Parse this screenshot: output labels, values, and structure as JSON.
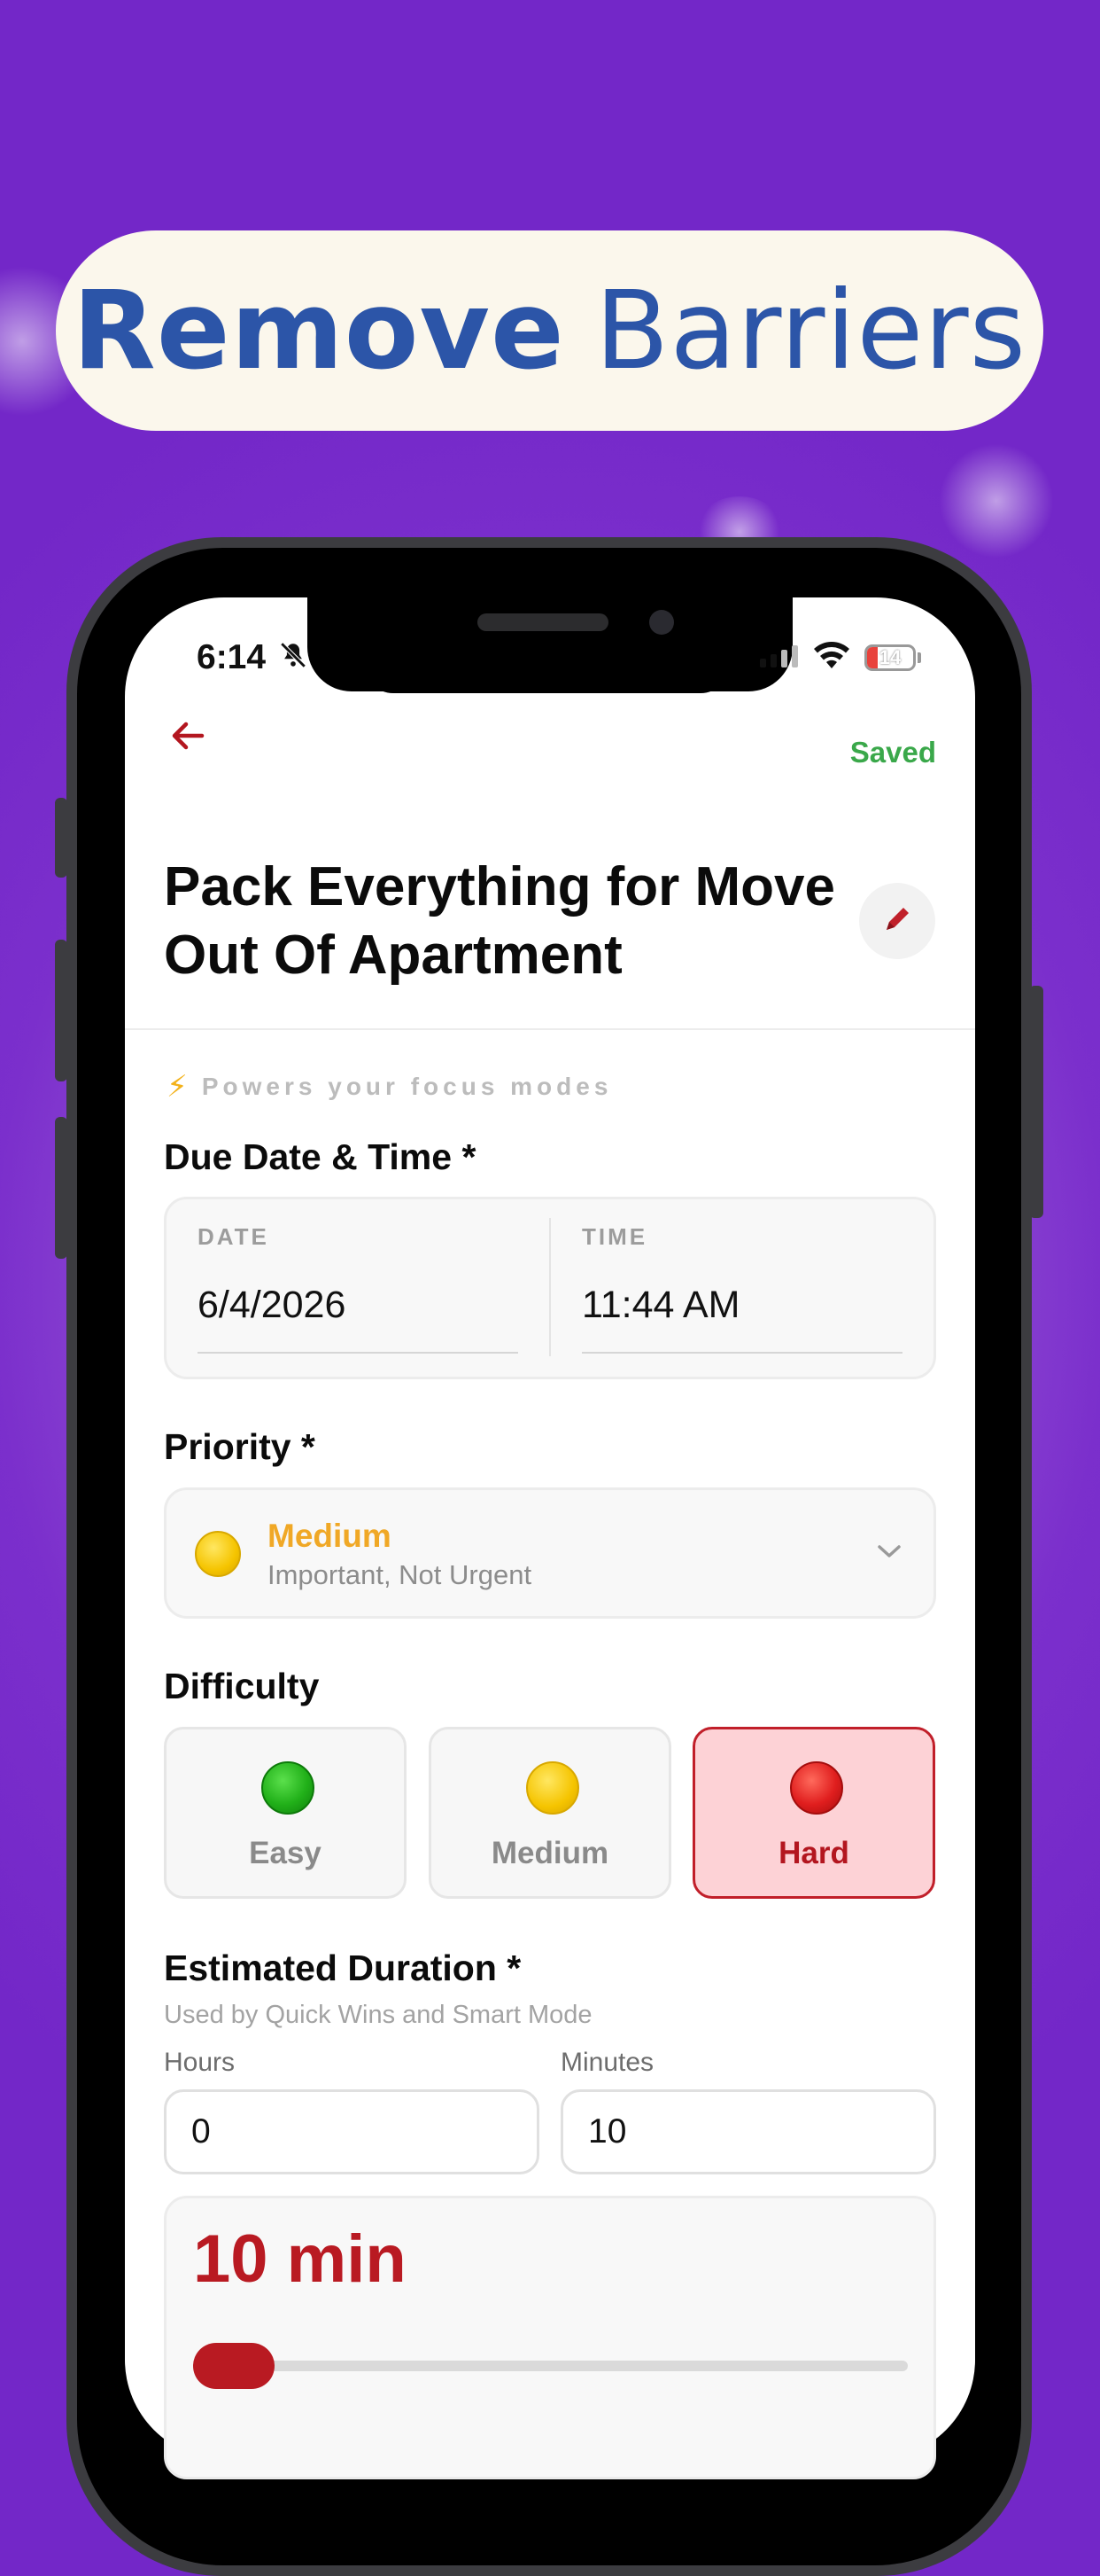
{
  "promo": {
    "headline_bold": "Remove",
    "headline_light": "Barriers"
  },
  "status_bar": {
    "time": "6:14",
    "battery": "14"
  },
  "header": {
    "back_icon": "arrow-left-icon",
    "save_status": "Saved"
  },
  "task": {
    "title": "Pack Everything for Move Out Of Apartment",
    "edit_icon": "pencil-icon"
  },
  "focus_hint": {
    "icon": "lightning-icon",
    "text": "Powers your focus modes"
  },
  "due": {
    "label": "Due Date & Time *",
    "date_caption": "DATE",
    "date_value": "6/4/2026",
    "time_caption": "TIME",
    "time_value": "11:44 AM"
  },
  "priority": {
    "label": "Priority *",
    "name": "Medium",
    "description": "Important, Not Urgent",
    "color": "#f0a826"
  },
  "difficulty": {
    "label": "Difficulty",
    "options": [
      {
        "label": "Easy",
        "color": "green",
        "selected": false
      },
      {
        "label": "Medium",
        "color": "yellow",
        "selected": false
      },
      {
        "label": "Hard",
        "color": "red",
        "selected": true
      }
    ]
  },
  "duration": {
    "label": "Estimated Duration *",
    "hint": "Used by Quick Wins and Smart Mode",
    "hours_label": "Hours",
    "hours_value": "0",
    "minutes_label": "Minutes",
    "minutes_value": "10",
    "summary": "10 min",
    "accent": "#b91a22"
  },
  "colors": {
    "background": "#7327c8",
    "headline": "#2c55a8",
    "saved": "#3aa84a",
    "hard_selected_bg": "#fdd2d6"
  }
}
